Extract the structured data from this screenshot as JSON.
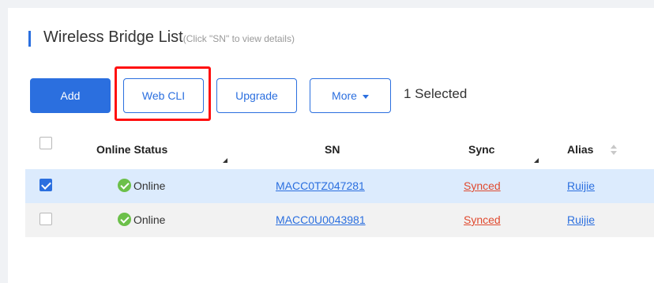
{
  "header": {
    "title": "Wireless Bridge List",
    "hint": "(Click \"SN\" to view details)"
  },
  "toolbar": {
    "add_label": "Add",
    "webcli_label": "Web CLI",
    "upgrade_label": "Upgrade",
    "more_label": "More",
    "selected_text": "1 Selected"
  },
  "table": {
    "columns": [
      "Online Status",
      "SN",
      "Sync",
      "Alias"
    ],
    "rows": [
      {
        "checked": true,
        "status": "Online",
        "sn": "MACC0TZ047281",
        "sync": "Synced",
        "alias": "Ruijie"
      },
      {
        "checked": false,
        "status": "Online",
        "sn": "MACC0U0043981",
        "sync": "Synced",
        "alias": "Ruijie"
      }
    ]
  },
  "colors": {
    "primary": "#2b6fdf",
    "highlight": "#ff1010",
    "selected_row": "#dcebfd",
    "online": "#6cc04a",
    "sync_link": "#e04a2f"
  }
}
